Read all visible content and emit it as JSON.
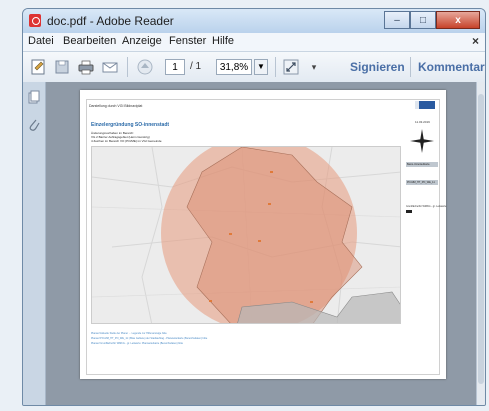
{
  "window": {
    "title": "doc.pdf - Adobe Reader",
    "controls": {
      "minimize": "–",
      "maximize": "□",
      "close": "x"
    }
  },
  "menubar": {
    "items": [
      "Datei",
      "Bearbeiten",
      "Anzeige",
      "Fenster",
      "Hilfe"
    ],
    "close": "×"
  },
  "toolbar": {
    "page_current": "1",
    "page_total": "/ 1",
    "zoom": "31,8%",
    "sign_label": "Signieren",
    "comment_label": "Kommentar"
  },
  "document": {
    "header_left": "Darstellung durch VGI Bildnaviplat",
    "title": "Einzelergründung SO-innenstadt",
    "date": "11.03.2019",
    "subtitle_lines": [
      "Änderungsvorhaben im Bereich:",
      "VG 2 Barrier Auftragsgebiet (Heim Gunstrig)",
      "4 Zeichen im Bereich VO (PO/ME) im VGI Gemeinde"
    ],
    "legend": {
      "title": "Basis-Unterlaufkarte",
      "item1": "PO-MM_HT_PO_WE_11",
      "item2": "Grunfläche/für WMKG - gr. Leitwerte"
    },
    "footer_lines": [
      "Planauf Aktuelle Stelle der Planer ... Legende zur Hilfenanzeige bitte",
      "Planauf PO-MM_HT_PO_WE_11: (Blau Gebiete) der Stadtauftrag - Planweiterkarte (Bereichsdaten) bitte",
      "Planauf Grunfläche/für WMKG - gr. Leitwerte: Planweiterkarte (Bereichsdaten) bitte"
    ]
  }
}
